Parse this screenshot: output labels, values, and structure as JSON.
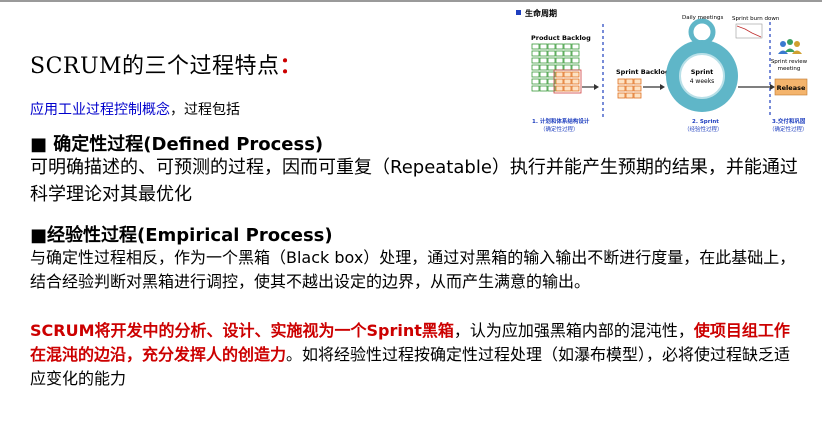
{
  "slide": {
    "title": "SCRUM的三个过程特点",
    "title_colon": "：",
    "intro_highlight": "应用工业过程控制概念",
    "intro_rest": "，过程包括",
    "defined": {
      "bullet": "■",
      "heading_cn": " 确定性过程",
      "heading_en": "(Defined Process)",
      "body": "可明确描述的、可预测的过程，因而可重复（Repeatable）执行并能产生预期的结果，并能通过科学理论对其最优化"
    },
    "empirical": {
      "bullet": "■",
      "heading_cn": "经验性过程",
      "heading_en": "(Empirical Process)",
      "body": "与确定性过程相反，作为一个黑箱（Black box）处理，通过对黑箱的输入输出不断进行度量，在此基础上，结合经验判断对黑箱进行调控，使其不越出设定的边界，从而产生满意的输出。"
    },
    "scrum": {
      "lead": "SCRUM",
      "red1": "将开发中的分析、设计、实施视为一个Sprint黑箱",
      "mid": "，认为应加强黑箱内部的混沌性，",
      "red2": "使项目组工作在混沌的边沿，充分发挥人的创造力",
      "tail": "。如将经验性过程按确定性过程处理（如瀑布模型），必将使过程缺乏适应变化的能力"
    }
  },
  "diagram": {
    "header": "生命周期",
    "product_backlog": "Product Backlog",
    "daily_meetings": "Daily meetings",
    "sprint_burn_down": "Sprint burn down",
    "sprint_backlog": "Sprint Backlog",
    "sprint_label": "Sprint",
    "sprint_weeks": "4 weeks",
    "review_line1": "Sprint review",
    "review_line2": "meeting",
    "release": "Release",
    "phase1_line1": "1. 计划和体系结构设计",
    "phase1_line2": "（确定性过程）",
    "phase2_line1": "2. Sprint",
    "phase2_line2": "（经验性过程）",
    "phase3_line1": "3.交付和巩固",
    "phase3_line2": "（确定性过程）",
    "colors": {
      "grid_green": "#3a9a3a",
      "grid_orange": "#e07020",
      "circle_teal": "#5fb6c8",
      "release_fill": "#f4b46c",
      "phase_blue": "#1f3fbf"
    }
  }
}
